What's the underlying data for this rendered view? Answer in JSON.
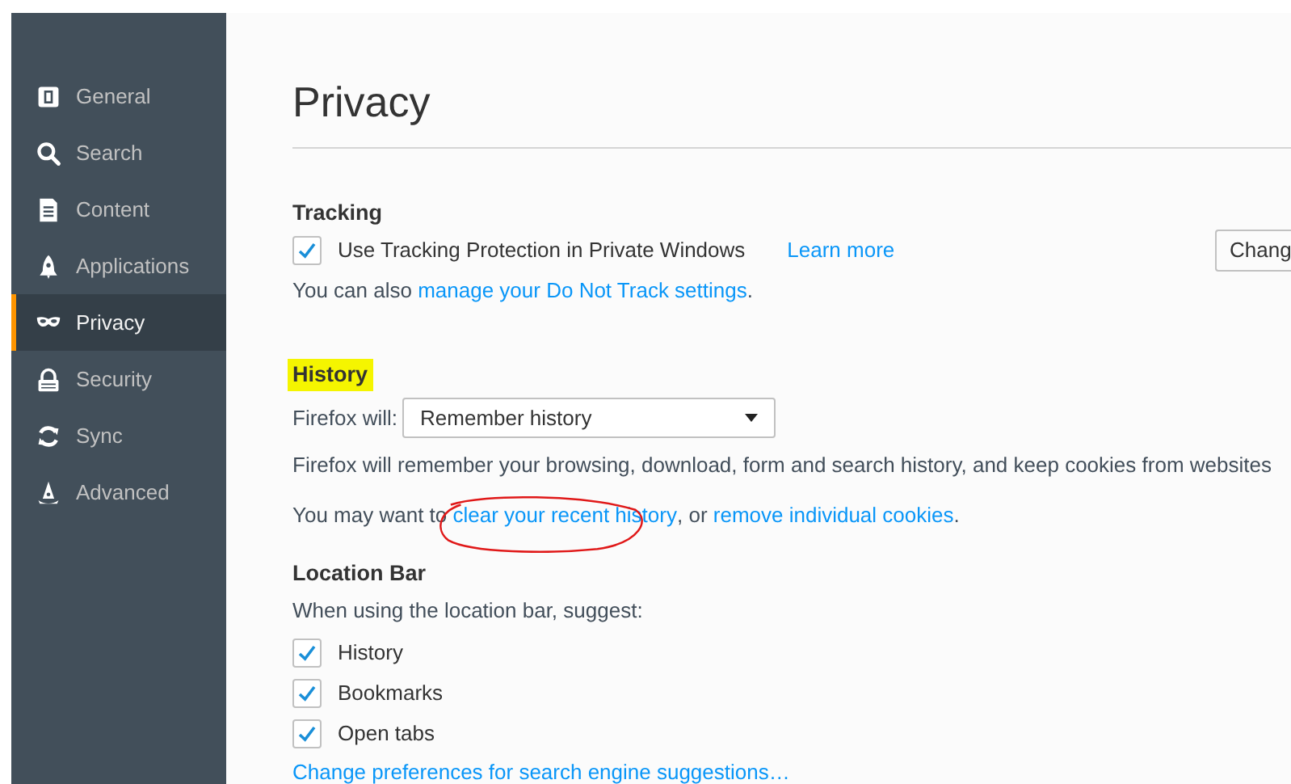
{
  "sidebar": {
    "items": [
      {
        "label": "General",
        "selected": false
      },
      {
        "label": "Search",
        "selected": false
      },
      {
        "label": "Content",
        "selected": false
      },
      {
        "label": "Applications",
        "selected": false
      },
      {
        "label": "Privacy",
        "selected": true
      },
      {
        "label": "Security",
        "selected": false
      },
      {
        "label": "Sync",
        "selected": false
      },
      {
        "label": "Advanced",
        "selected": false
      }
    ]
  },
  "page": {
    "title": "Privacy"
  },
  "tracking": {
    "heading": "Tracking",
    "checkbox": {
      "label": "Use Tracking Protection in Private Windows",
      "checked": true
    },
    "learn_more": "Learn more",
    "button": "Chang",
    "note": {
      "text": "You can also ",
      "link": "manage your Do Not Track settings",
      "after": "."
    }
  },
  "history": {
    "heading": "History",
    "highlighted": true,
    "select_label": "Firefox will:",
    "select_value": "Remember history",
    "description": "Firefox will remember your browsing, download, form and search history, and keep cookies from websites",
    "line": [
      {
        "kind": "text",
        "text": "You may want to "
      },
      {
        "kind": "link",
        "text": "clear your recent history",
        "circled": true
      },
      {
        "kind": "text",
        "text": ", or "
      },
      {
        "kind": "link",
        "text": "remove individual cookies",
        "circled": false
      },
      {
        "kind": "text",
        "text": "."
      }
    ]
  },
  "location_bar": {
    "heading": "Location Bar",
    "intro": "When using the location bar, suggest:",
    "options": [
      {
        "label": "History",
        "checked": true
      },
      {
        "label": "Bookmarks",
        "checked": true
      },
      {
        "label": "Open tabs",
        "checked": true
      }
    ],
    "link": "Change preferences for search engine suggestions…"
  }
}
